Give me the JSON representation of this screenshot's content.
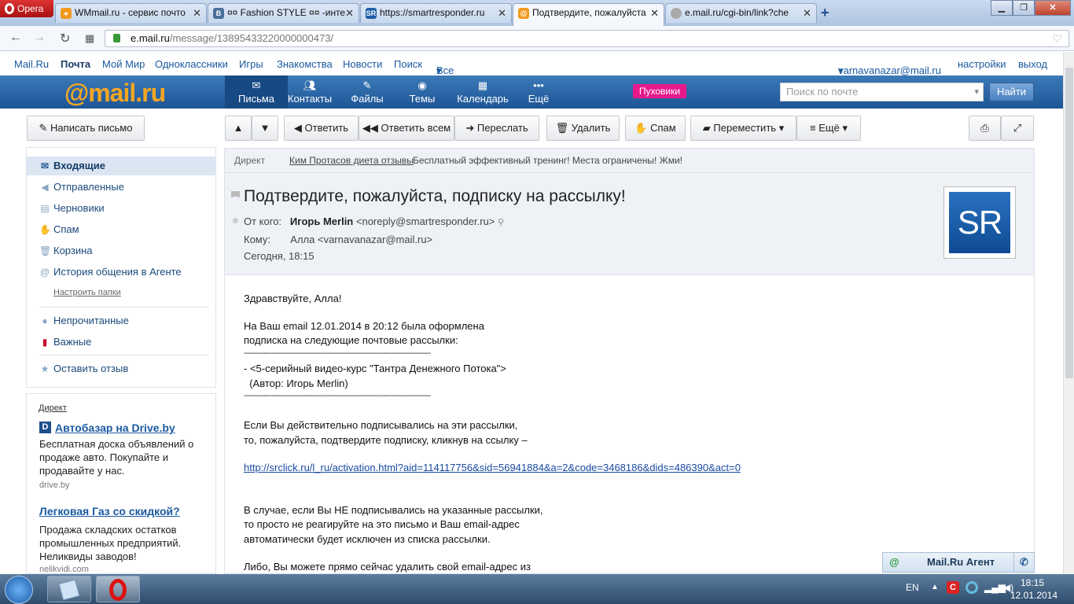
{
  "browser": {
    "menu_label": "Opera",
    "tabs": [
      {
        "label": "WMmail.ru - сервис почто",
        "icon": "wmmail-icon"
      },
      {
        "label": "¤¤ Fashion STYLE ¤¤ -инте",
        "icon": "vk-icon"
      },
      {
        "label": "https://smartresponder.ru",
        "icon": "smartresponder-icon"
      },
      {
        "label": "Подтвердите, пожалуйста",
        "icon": "mailru-icon"
      },
      {
        "label": "e.mail.ru/cgi-bin/link?che",
        "icon": "loading-icon"
      }
    ],
    "url_domain": "e.mail.ru",
    "url_path": "/message/13895433220000000473/"
  },
  "portal": {
    "links": [
      "Mail.Ru",
      "Почта",
      "Мой Мир",
      "Одноклассники",
      "Игры",
      "Знакомства",
      "Новости",
      "Поиск",
      "Все проекты"
    ],
    "user": "varnavanazar@mail.ru",
    "settings": "настройки",
    "logout": "выход"
  },
  "mailheader": {
    "logo_at": "@",
    "logo_text": "mail.ru",
    "tabs": [
      "Письма",
      "Контакты",
      "Файлы",
      "Темы",
      "Календарь",
      "Ещё"
    ],
    "promo": "Пуховики",
    "search_placeholder": "Поиск по почте",
    "search_button": "Найти"
  },
  "toolbar": {
    "compose": "Написать письмо",
    "reply": "Ответить",
    "reply_all": "Ответить всем",
    "forward": "Переслать",
    "delete": "Удалить",
    "spam": "Спам",
    "move": "Переместить",
    "more": "Ещё"
  },
  "folders": {
    "items": [
      "Входящие",
      "Отправленные",
      "Черновики",
      "Спам",
      "Корзина",
      "История общения в Агенте"
    ],
    "configure": "Настроить папки",
    "filters": [
      "Непрочитанные",
      "Важные"
    ],
    "feedback": "Оставить отзыв"
  },
  "ads": {
    "label": "Директ",
    "items": [
      {
        "title": "Автобазар на Drive.by",
        "text": "Бесплатная доска объявлений о продаже авто. Покупайте и продавайте у нас.",
        "domain": "drive.by"
      },
      {
        "title": "Легковая Газ со скидкой?",
        "text": "Продажа складских остатков промышленных предприятий. Неликвиды заводов!",
        "domain": "nelikvidi.com"
      }
    ]
  },
  "direkt_bar": {
    "label": "Директ",
    "link": "Ким Протасов диета отзывы",
    "text": "Бесплатный эффективный тренинг! Места ограничены! Жми!"
  },
  "message": {
    "subject": "Подтвердите, пожалуйста, подписку на рассылку!",
    "from_label": "От кого:",
    "from_name": "Игорь Merlin",
    "from_email": "<noreply@smartresponder.ru>",
    "to_label": "Кому:",
    "to_value": "Алла <varnavanazar@mail.ru>",
    "date": "Сегодня, 18:15",
    "avatar_text": "SR",
    "body": [
      "Здравствуйте, Алла!",
      "На Ваш email 12.01.2014 в 20:12 была оформлена",
      "подписка на следующие почтовые рассылки:",
      "---------------------------------------------------------------------------------------",
      "- <5-серийный видео-курс \"Тантра Денежного Потока\">",
      "  (Автор: Игорь Merlin)",
      "---------------------------------------------------------------------------------------",
      "Если Вы действительно подписывались на эти рассылки,",
      "то, пожалуйста, подтвердите подписку, кликнув на ссылку –",
      "http://srclick.ru/l_ru/activation.html?aid=114117756&sid=56941884&a=2&code=3468186&dids=486390&act=0",
      "В случае, если Вы НЕ подписывались на указанные рассылки,",
      "то просто не реагируйте на это письмо и Ваш email-адрес",
      "автоматически будет исключен из списка рассылки.",
      "Либо, Вы можете прямо сейчас удалить свой email-адрес из"
    ]
  },
  "agent": {
    "label": "Mail.Ru Агент"
  },
  "taskbar": {
    "lang": "EN",
    "time": "18:15",
    "date": "12.01.2014"
  }
}
